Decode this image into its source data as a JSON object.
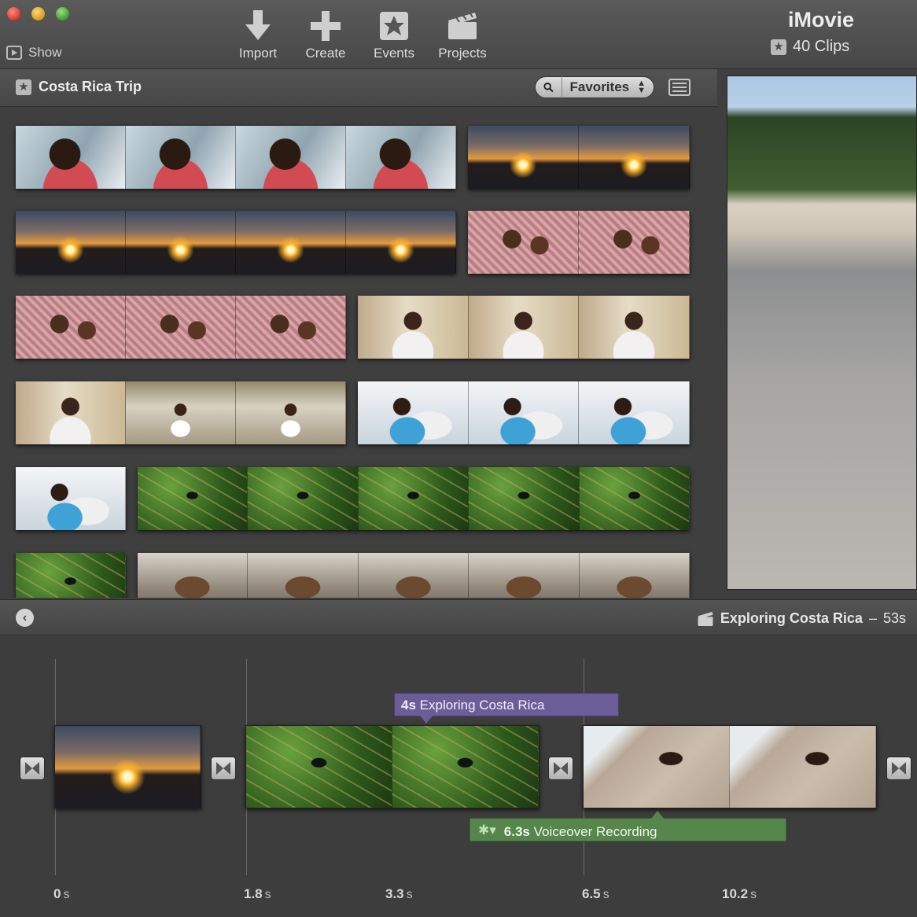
{
  "toolbar": {
    "show_label": "Show",
    "tools": [
      {
        "label": "Import",
        "icon": "import-arrow-icon"
      },
      {
        "label": "Create",
        "icon": "plus-icon"
      },
      {
        "label": "Events",
        "icon": "star-icon"
      },
      {
        "label": "Projects",
        "icon": "clapperboard-icon"
      }
    ],
    "app_title": "iMovie",
    "clip_count": "40 Clips"
  },
  "event": {
    "title": "Costa Rica Trip",
    "filter": "Favorites"
  },
  "project": {
    "title": "Exploring Costa Rica",
    "separator": "–",
    "duration": "53s"
  },
  "timeline": {
    "title_overlay": {
      "duration": "4s",
      "text": "Exploring Costa Rica"
    },
    "voiceover": {
      "duration": "6.3s",
      "text": "Voiceover Recording"
    },
    "ticks": [
      {
        "value": "0",
        "unit": "s"
      },
      {
        "value": "1.8",
        "unit": "s"
      },
      {
        "value": "3.3",
        "unit": "s"
      },
      {
        "value": "6.5",
        "unit": "s"
      },
      {
        "value": "10.2",
        "unit": "s"
      }
    ]
  },
  "colors": {
    "title_overlay": "#6b5d98",
    "voiceover": "#56864c",
    "toolbar": "#4f4f4f"
  }
}
